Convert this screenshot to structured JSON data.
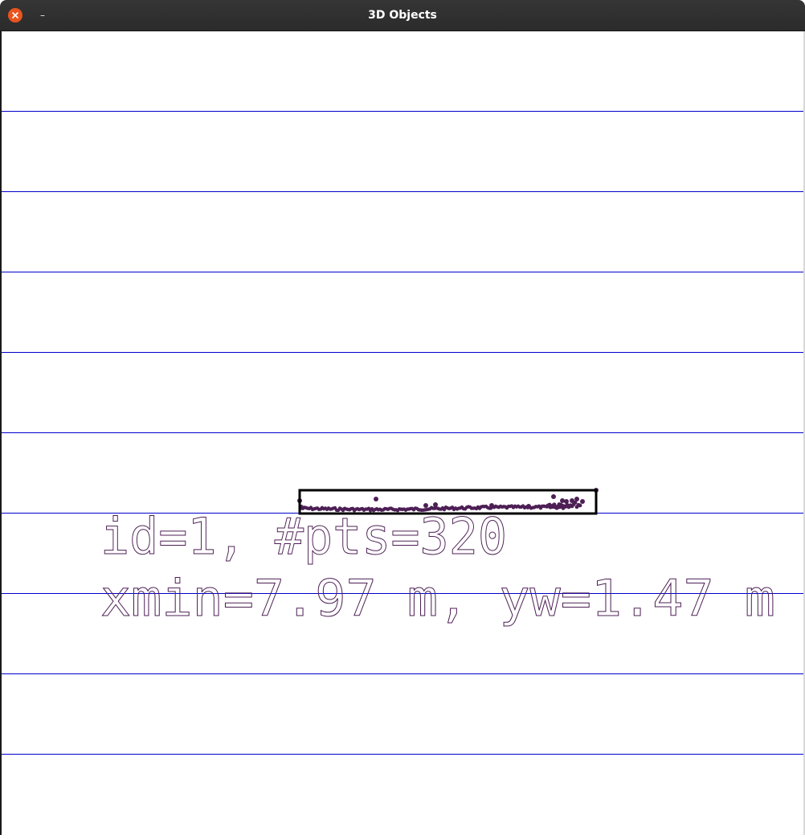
{
  "window": {
    "title": "3D Objects",
    "minimize_glyph": "–"
  },
  "viewer": {
    "grid_line_color": "#0000cc",
    "box_color": "#000000",
    "point_color": "#4d1f55",
    "text_color": "#4d1f55",
    "object": {
      "label_line1": "id=1, #pts=320",
      "label_line2": "xmin=7.97 m, yw=1.47 m"
    }
  }
}
